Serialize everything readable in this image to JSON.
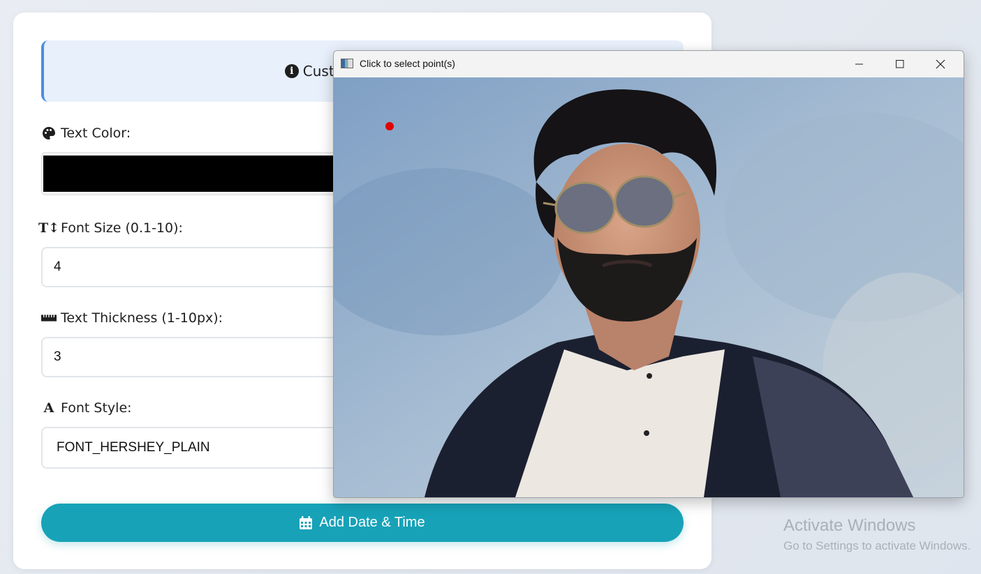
{
  "info": {
    "text": "Customize the appe"
  },
  "fields": {
    "text_color_label": "Text Color:",
    "text_color_value": "#000000",
    "font_size_label": "Font Size (0.1-10):",
    "font_size_value": "4",
    "thickness_label": "Text Thickness (1-10px):",
    "thickness_value": "3",
    "font_style_label": "Font Style:",
    "font_style_value": "FONT_HERSHEY_PLAIN"
  },
  "actions": {
    "add_label": "Add Date & Time"
  },
  "popup": {
    "title": "Click to select point(s)",
    "image_description_icon": "portrait-photo"
  },
  "watermark": {
    "line1": "Activate Windows",
    "line2": "Go to Settings to activate Windows."
  },
  "colors": {
    "accent": "#17a2b8",
    "info_border": "#4a8fe0",
    "info_bg": "#e8f0fb",
    "marker": "#e00000"
  }
}
